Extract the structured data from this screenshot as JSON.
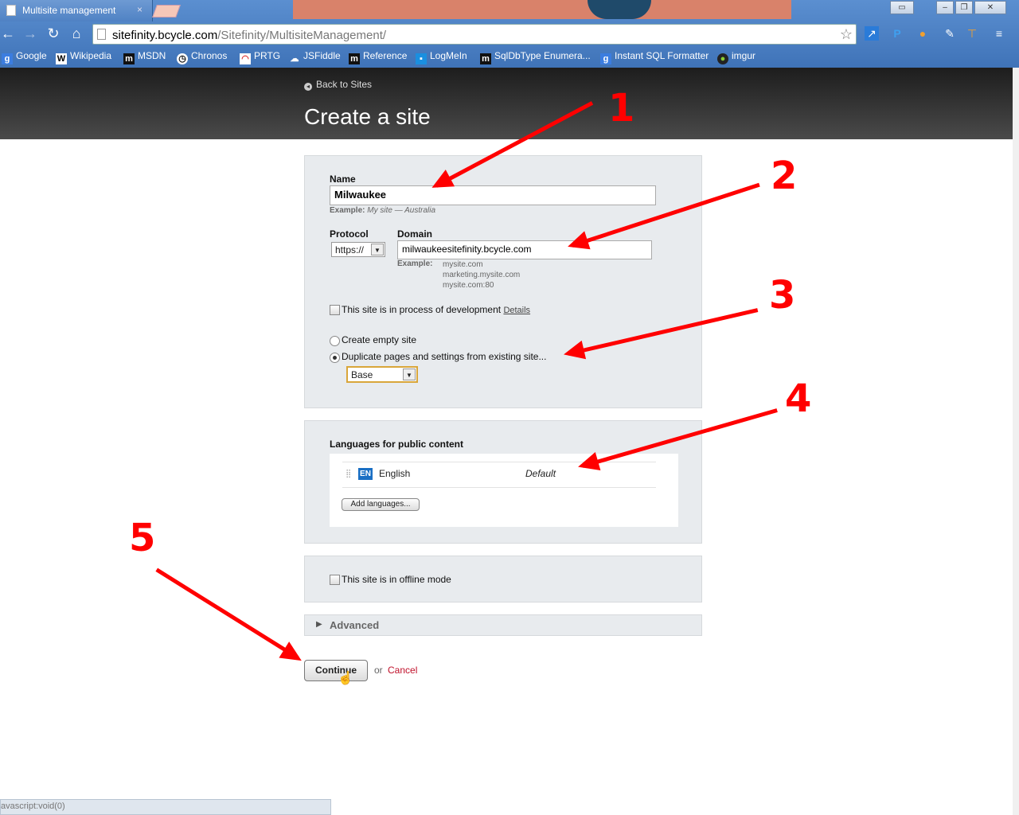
{
  "browser": {
    "tab_title": "Multisite management",
    "tab_close": "×",
    "url_host": "sitefinity.bcycle.com",
    "url_path": "/Sitefinity/MultisiteManagement/",
    "bookmarks": [
      "Google",
      "Wikipedia",
      "MSDN",
      "Chronos",
      "PRTG",
      "JSFiddle",
      "Reference",
      "LogMeIn",
      "SqlDbType Enumera...",
      "Instant SQL Formatter",
      "imgur"
    ],
    "status_text": "avascript:void(0)"
  },
  "header": {
    "back_label": "Back to Sites",
    "title": "Create a site"
  },
  "form": {
    "name_label": "Name",
    "name_value": "Milwaukee",
    "name_example_prefix": "Example:",
    "name_example_text": "My site — Australia",
    "protocol_label": "Protocol",
    "protocol_value": "https://",
    "domain_label": "Domain",
    "domain_value": "milwaukeesitefinity.bcycle.com",
    "domain_example_prefix": "Example:",
    "domain_examples": [
      "mysite.com",
      "marketing.mysite.com",
      "mysite.com:80"
    ],
    "dev_checkbox_label": "This site is in process of development",
    "dev_details_link": "Details",
    "dev_checked": false,
    "radio_empty_label": "Create empty site",
    "radio_duplicate_label": "Duplicate pages and settings from existing site...",
    "duplicate_selected": true,
    "source_site_value": "Base"
  },
  "languages": {
    "heading": "Languages for public content",
    "items": [
      {
        "code": "EN",
        "name": "English",
        "note": "Default"
      }
    ],
    "add_label": "Add languages..."
  },
  "offline": {
    "label": "This site is in offline mode",
    "checked": false
  },
  "advanced": {
    "label": "Advanced"
  },
  "actions": {
    "continue_label": "Continue",
    "or_text": "or",
    "cancel_label": "Cancel"
  },
  "annotations": [
    "1",
    "2",
    "3",
    "4",
    "5"
  ],
  "colors": {
    "annotation": "#ff0000",
    "header_dark": "#2b2b2b",
    "cancel": "#c0102a",
    "lang_badge": "#1a6fc4"
  }
}
